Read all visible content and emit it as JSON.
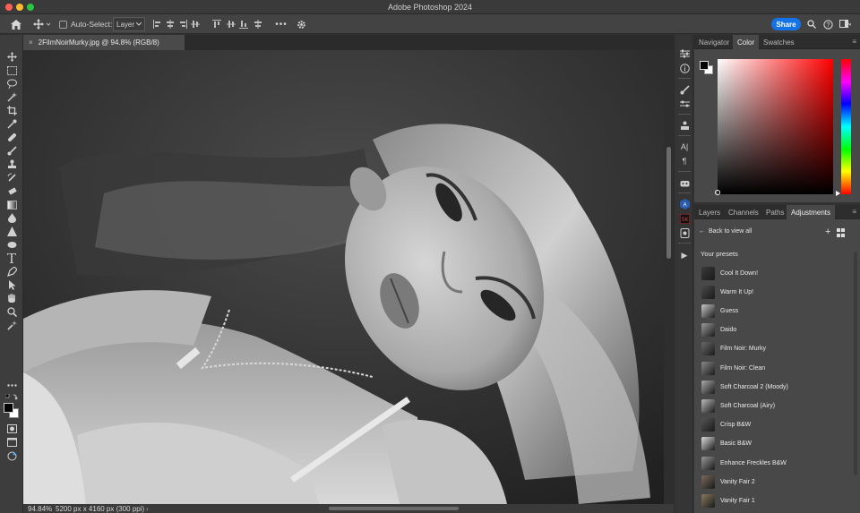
{
  "window": {
    "title": "Adobe Photoshop 2024"
  },
  "options_bar": {
    "auto_select_label": "Auto-Select:",
    "auto_select_target": "Layer",
    "share_label": "Share",
    "more_label": "•••"
  },
  "document": {
    "tab_title": "2FilmNoirMurky.jpg @ 94.8% (RGB/8)",
    "tab_close": "×"
  },
  "status_bar": {
    "zoom": "94.84%",
    "doc_info": "5200 px x 4160 px (300 ppi)",
    "chevron": "›"
  },
  "panels": {
    "top_tabs": [
      "Navigator",
      "Color",
      "Swatches"
    ],
    "top_active": "Color",
    "bottom_tabs": [
      "Layers",
      "Channels",
      "Paths",
      "Adjustments"
    ],
    "bottom_active": "Adjustments",
    "menu_icon": "≡",
    "colors": {
      "foreground": "#000000",
      "background": "#ffffff",
      "selected": "#000000"
    }
  },
  "adjustments": {
    "back_label": "Back to view all",
    "back_icon": "←",
    "add_icon": "+",
    "presets_heading": "Your presets",
    "presets": [
      "Cool It Down!",
      "Warm It Up!",
      "Guess",
      "Daido",
      "Film Noir: Murky",
      "Film Noir: Clean",
      "Soft Charcoal 2 (Moody)",
      "Soft Charcoal (Airy)",
      "Crisp B&W",
      "Basic B&W",
      "Enhance Freckles B&W",
      "Vanity Fair 2",
      "Vanity Fair 1"
    ]
  },
  "dock": {
    "text_icon": "A|",
    "para_icon": "¶",
    "play_icon": "▶"
  },
  "accent": "#1473e6"
}
